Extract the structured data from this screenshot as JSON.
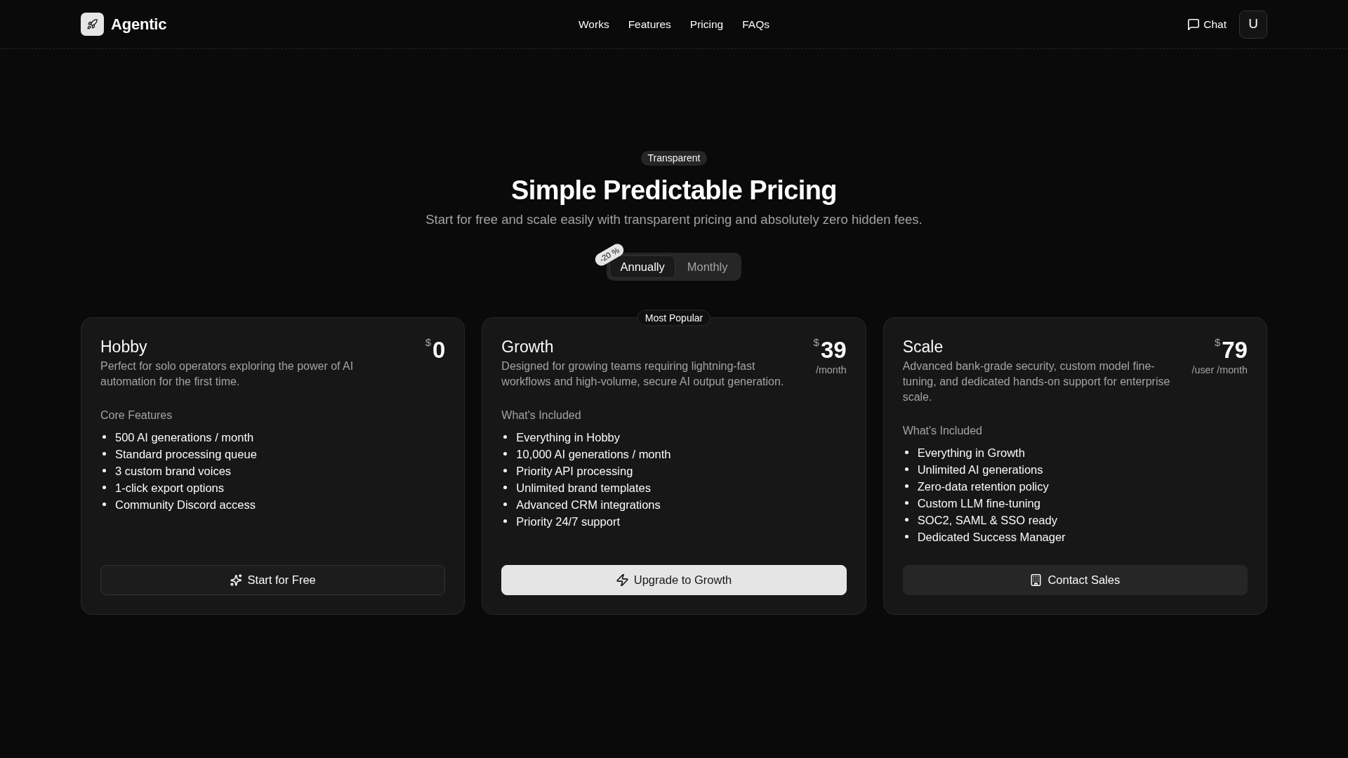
{
  "header": {
    "brand": "Agentic",
    "nav": [
      "Works",
      "Features",
      "Pricing",
      "FAQs"
    ],
    "chat_button": "Chat",
    "user_avatar": "U"
  },
  "hero": {
    "badge": "Transparent",
    "title": "Simple Predictable Pricing",
    "subtitle": "Start for free and scale easily with transparent pricing and absolutely zero hidden fees.",
    "billing_toggle": {
      "discount_tag": "-20 %",
      "options": [
        {
          "label": "Annually",
          "selected": true
        },
        {
          "label": "Monthly",
          "selected": false
        }
      ]
    }
  },
  "plans": [
    {
      "name": "Hobby",
      "currency": "$",
      "price": "0",
      "description": "Perfect for solo operators exploring the power of AI automation for the first time.",
      "features_title": "Core Features",
      "features": [
        "500 AI generations / month",
        "Standard processing queue",
        "3 custom brand voices",
        "1-click export options",
        "Community Discord access"
      ],
      "button": {
        "label": "Start for Free",
        "kind": "outline"
      }
    },
    {
      "name": "Growth",
      "badge": "Most Popular",
      "currency": "$",
      "price": "39",
      "period": "/month",
      "description": "Designed for growing teams requiring lightning-fast workflows and high-volume, secure AI output generation.",
      "features_title": "What's Included",
      "features": [
        "Everything in Hobby",
        "10,000 AI generations / month",
        "Priority API processing",
        "Unlimited brand templates",
        "Advanced CRM integrations",
        "Priority 24/7 support"
      ],
      "button": {
        "label": "Upgrade to Growth",
        "kind": "primary"
      }
    },
    {
      "name": "Scale",
      "currency": "$",
      "price": "79",
      "period": "/user /month",
      "description": "Advanced bank-grade security, custom model fine-tuning, and dedicated hands-on support for enterprise scale.",
      "features_title": "What's Included",
      "features": [
        "Everything in Growth",
        "Unlimited AI generations",
        "Zero-data retention policy",
        "Custom LLM fine-tuning",
        "SOC2, SAML & SSO ready",
        "Dedicated Success Manager"
      ],
      "button": {
        "label": "Contact Sales",
        "kind": "secondary"
      }
    }
  ]
}
